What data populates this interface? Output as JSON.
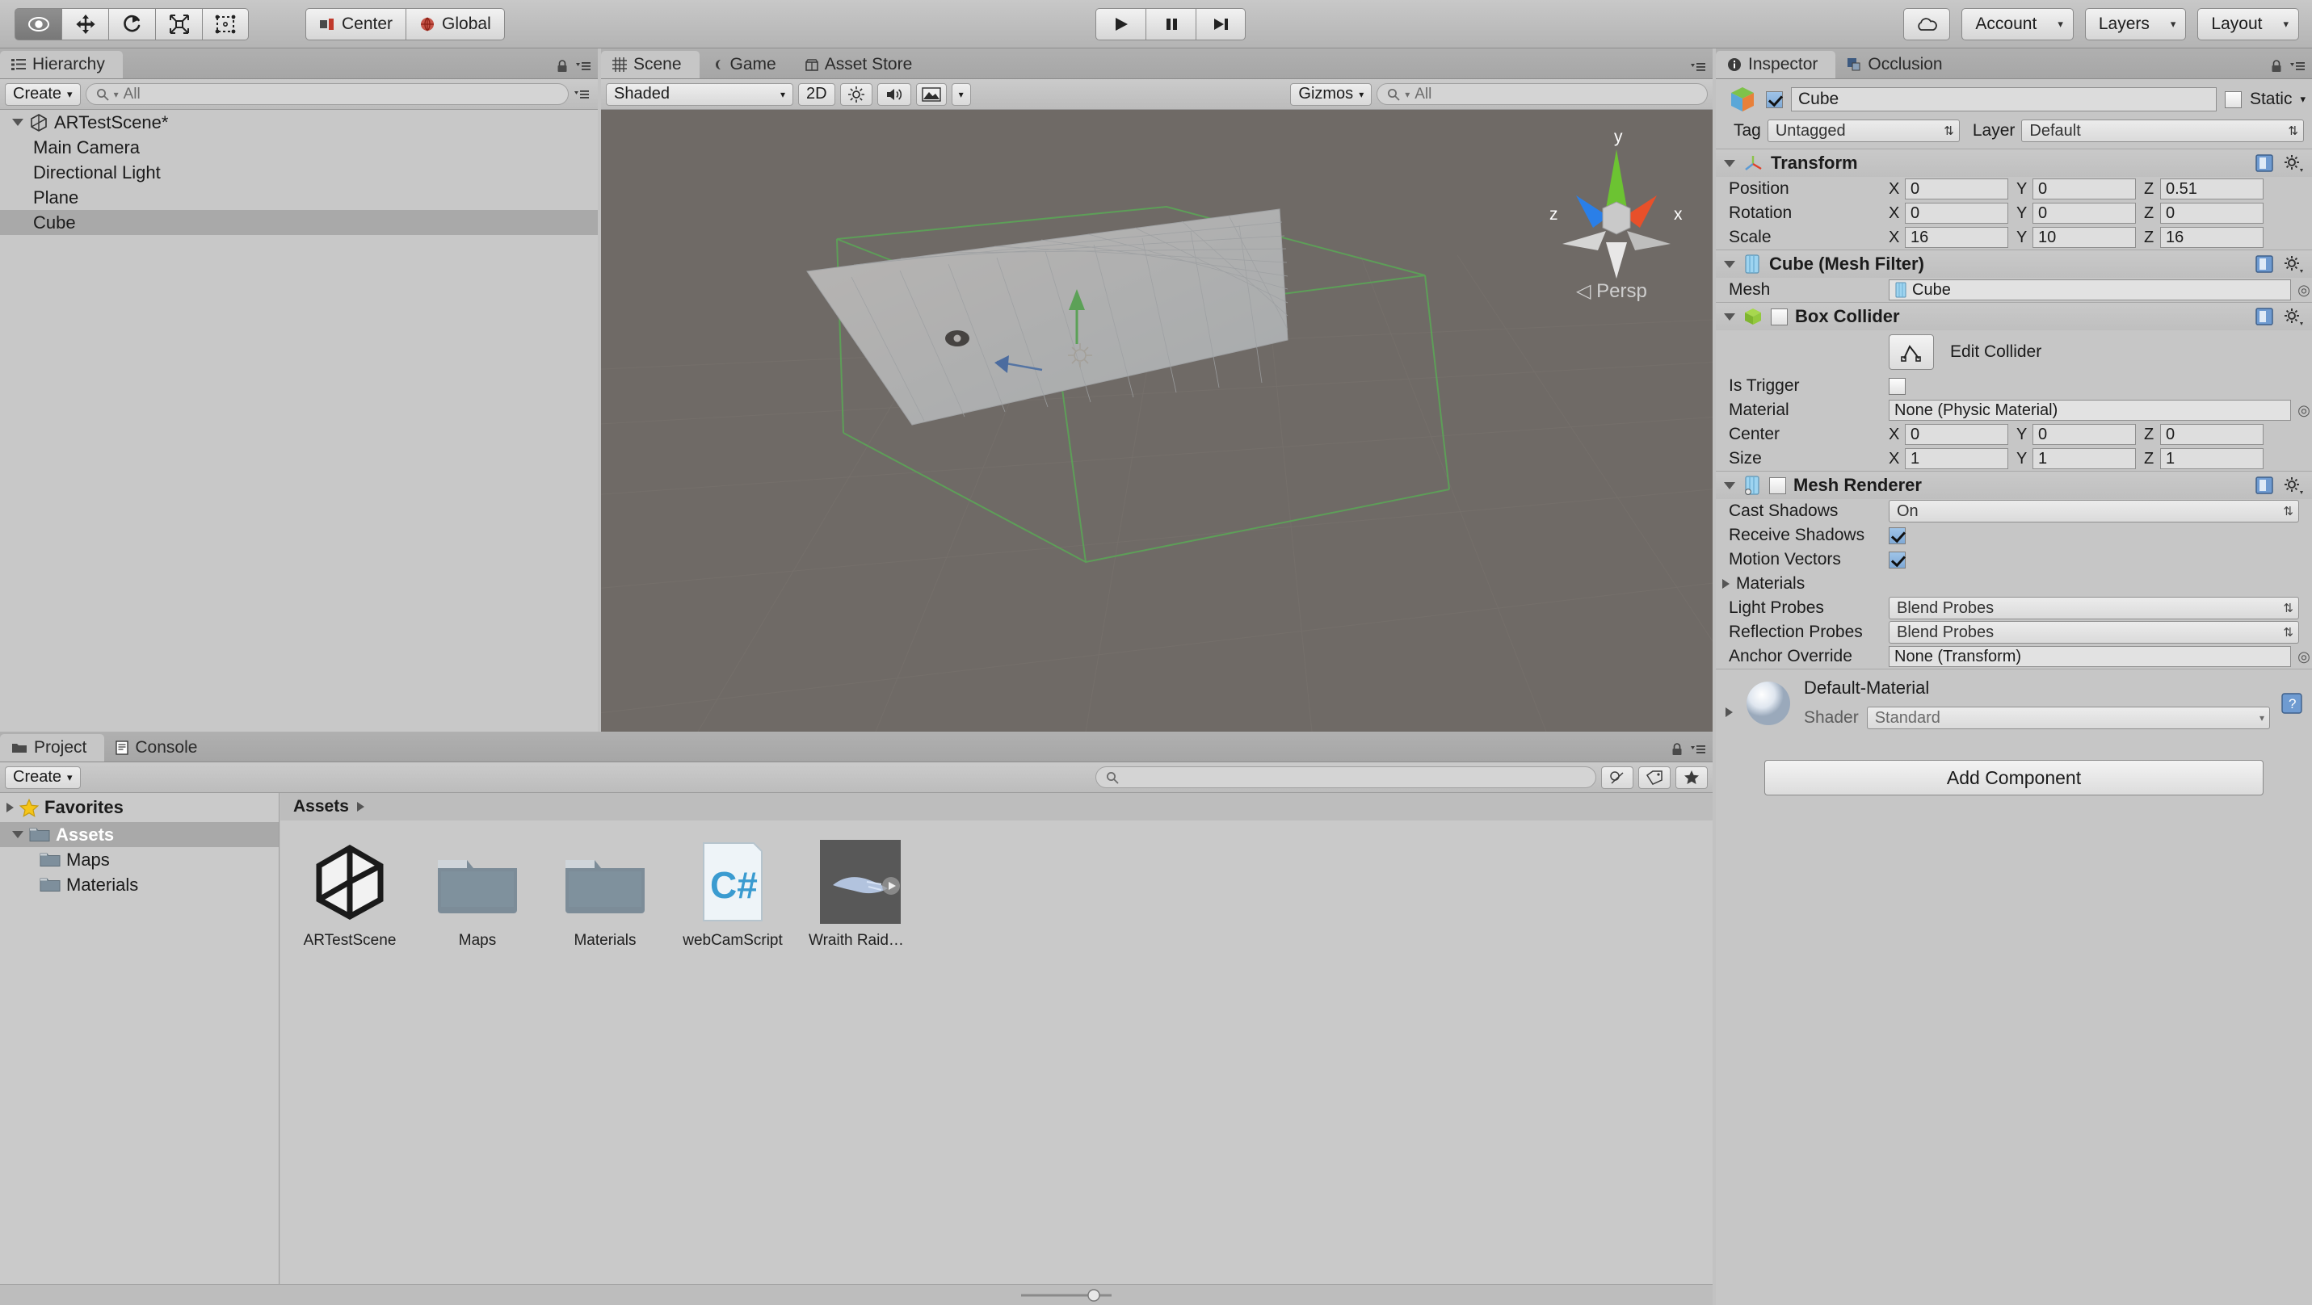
{
  "toolbar": {
    "tools": [
      {
        "name": "hand-tool",
        "icon": "eye",
        "active": true
      },
      {
        "name": "move-tool",
        "icon": "move",
        "active": false
      },
      {
        "name": "rotate-tool",
        "icon": "rotate",
        "active": false
      },
      {
        "name": "scale-tool",
        "icon": "scale",
        "active": false
      },
      {
        "name": "rect-tool",
        "icon": "rect",
        "active": false
      }
    ],
    "pivot_label": "Center",
    "space_label": "Global",
    "play_label": "play-icon",
    "pause_label": "pause-icon",
    "step_label": "step-icon",
    "cloud_label": "cloud-icon",
    "account_label": "Account",
    "layers_label": "Layers",
    "layout_label": "Layout"
  },
  "hierarchy": {
    "tab_label": "Hierarchy",
    "create_label": "Create",
    "search_placeholder": "All",
    "items": [
      {
        "label": "ARTestScene*",
        "depth": 0,
        "icon": "unity-scene-icon",
        "selected": false,
        "expanded": true
      },
      {
        "label": "Main Camera",
        "depth": 1,
        "icon": "none",
        "selected": false
      },
      {
        "label": "Directional Light",
        "depth": 1,
        "icon": "none",
        "selected": false
      },
      {
        "label": "Plane",
        "depth": 1,
        "icon": "none",
        "selected": false
      },
      {
        "label": "Cube",
        "depth": 1,
        "icon": "none",
        "selected": true
      }
    ]
  },
  "scene": {
    "tabs": [
      {
        "label": "Scene",
        "icon": "grid-icon",
        "selected": true
      },
      {
        "label": "Game",
        "icon": "gamepad-icon",
        "selected": false
      },
      {
        "label": "Asset Store",
        "icon": "store-icon",
        "selected": false
      }
    ],
    "draw_mode": "Shaded",
    "two_d_label": "2D",
    "gizmos_label": "Gizmos",
    "search_placeholder": "All",
    "axis_x": "x",
    "axis_y": "y",
    "axis_z": "z",
    "perspective_label": "Persp"
  },
  "inspector": {
    "tabs": [
      {
        "label": "Inspector",
        "icon": "info-icon",
        "selected": true
      },
      {
        "label": "Occlusion",
        "icon": "occlusion-icon",
        "selected": false
      }
    ],
    "object_name": "Cube",
    "object_enabled": true,
    "static_label": "Static",
    "static_checked": false,
    "tag_label": "Tag",
    "tag_value": "Untagged",
    "layer_label": "Layer",
    "layer_value": "Default",
    "components": [
      {
        "title": "Transform",
        "icon": "transform-icon",
        "has_checkbox": false,
        "vector_rows": [
          {
            "label": "Position",
            "x": "0",
            "y": "0",
            "z": "0.51"
          },
          {
            "label": "Rotation",
            "x": "0",
            "y": "0",
            "z": "0"
          },
          {
            "label": "Scale",
            "x": "16",
            "y": "10",
            "z": "16"
          }
        ]
      },
      {
        "title": "Cube (Mesh Filter)",
        "icon": "mesh-filter-icon",
        "has_checkbox": false,
        "object_rows": [
          {
            "label": "Mesh",
            "value": "Cube",
            "icon": "mesh-icon"
          }
        ]
      },
      {
        "title": "Box Collider",
        "icon": "box-collider-icon",
        "has_checkbox": true,
        "checked": false,
        "edit_collider_label": "Edit Collider",
        "bool_rows": [
          {
            "label": "Is Trigger",
            "checked": false
          }
        ],
        "object_rows": [
          {
            "label": "Material",
            "value": "None (Physic Material)",
            "icon": "none"
          }
        ],
        "vector_rows": [
          {
            "label": "Center",
            "x": "0",
            "y": "0",
            "z": "0"
          },
          {
            "label": "Size",
            "x": "1",
            "y": "1",
            "z": "1"
          }
        ]
      },
      {
        "title": "Mesh Renderer",
        "icon": "mesh-renderer-icon",
        "has_checkbox": true,
        "checked": false,
        "enum_rows": [
          {
            "label": "Cast Shadows",
            "value": "On"
          }
        ],
        "bool_rows": [
          {
            "label": "Receive Shadows",
            "checked": true
          },
          {
            "label": "Motion Vectors",
            "checked": true
          }
        ],
        "foldout_rows": [
          {
            "label": "Materials"
          }
        ],
        "enum_rows2": [
          {
            "label": "Light Probes",
            "value": "Blend Probes"
          },
          {
            "label": "Reflection Probes",
            "value": "Blend Probes"
          }
        ],
        "object_rows": [
          {
            "label": "Anchor Override",
            "value": "None (Transform)",
            "icon": "none"
          }
        ]
      }
    ],
    "material": {
      "name": "Default-Material",
      "shader_label": "Shader",
      "shader_value": "Standard"
    },
    "add_component_label": "Add Component"
  },
  "project": {
    "tabs": [
      {
        "label": "Project",
        "icon": "folder-icon",
        "selected": true
      },
      {
        "label": "Console",
        "icon": "console-icon",
        "selected": false
      }
    ],
    "create_label": "Create",
    "search_placeholder": "",
    "favorites_label": "Favorites",
    "tree": [
      {
        "label": "Assets",
        "depth": 0,
        "selected": true,
        "expanded": true
      },
      {
        "label": "Maps",
        "depth": 1,
        "selected": false
      },
      {
        "label": "Materials",
        "depth": 1,
        "selected": false
      }
    ],
    "breadcrumb": "Assets",
    "assets": [
      {
        "name": "ARTestScene",
        "type": "unity-scene"
      },
      {
        "name": "Maps",
        "type": "folder"
      },
      {
        "name": "Materials",
        "type": "folder"
      },
      {
        "name": "webCamScript",
        "type": "csharp-script"
      },
      {
        "name": "Wraith Raider...",
        "type": "model-preview"
      }
    ]
  },
  "colors": {
    "accent_blue": "#7fa9d6",
    "panel_bg": "#c2c2c2",
    "scene_bg": "#6f6a66",
    "selection": "#a9a9a9",
    "axis_x": "#e8502a",
    "axis_y": "#6cc332",
    "axis_z": "#2a7fe8"
  }
}
